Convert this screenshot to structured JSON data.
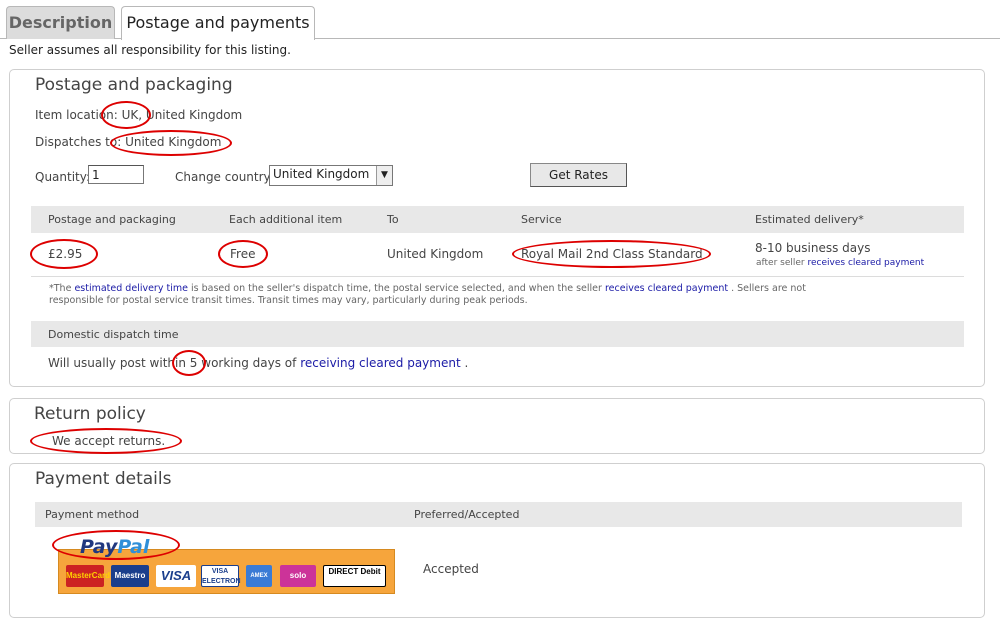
{
  "tabs": [
    {
      "label": "Description",
      "active": false
    },
    {
      "label": "Postage and payments",
      "active": true
    }
  ],
  "seller_note": "Seller assumes all responsibility for this listing.",
  "postage": {
    "title": "Postage and packaging",
    "item_location_label": "Item location:",
    "item_location_value": "UK, United Kingdom",
    "dispatches_label": "Dispatches to:",
    "dispatches_value": "United Kingdom",
    "quantity_label": "Quantity:",
    "quantity_value": "1",
    "country_label": "Change country:",
    "country_value": "United Kingdom",
    "get_rates_label": "Get Rates",
    "columns": [
      "Postage and packaging",
      "Each additional item",
      "To",
      "Service",
      "Estimated delivery*"
    ],
    "row": {
      "price": "£2.95",
      "additional": "Free",
      "to": "United Kingdom",
      "service": "Royal Mail 2nd Class Standard",
      "delivery": "8-10 business days",
      "delivery_note_prefix": "after seller",
      "delivery_note_link": "receives cleared payment"
    },
    "footnote_prefix": "*The",
    "footnote_link1": "estimated delivery time",
    "footnote_mid": "is based on the seller's dispatch time, the postal service selected, and when the seller",
    "footnote_link2": "receives cleared payment",
    "footnote_suffix": ". Sellers are not",
    "footnote_line2": "responsible for postal service transit times. Transit times may vary, particularly during peak periods.",
    "dispatch_header": "Domestic dispatch time",
    "dispatch_prefix": "Will usually post within",
    "dispatch_days": "5",
    "dispatch_mid": "working days of",
    "dispatch_link": "receiving cleared payment",
    "dispatch_suffix": "."
  },
  "returns": {
    "title": "Return policy",
    "text": "We accept returns."
  },
  "payment": {
    "title": "Payment details",
    "columns": [
      "Payment method",
      "Preferred/Accepted"
    ],
    "paypal_pay": "Pay",
    "paypal_pal": "Pal",
    "status": "Accepted",
    "cards": [
      {
        "label": "MasterCard",
        "bg": "#cc2222",
        "fg": "#ffd200"
      },
      {
        "label": "Maestro",
        "bg": "#1a3e8c",
        "fg": "#ffffff"
      },
      {
        "label": "VISA",
        "bg": "#ffffff",
        "fg": "#1a3e8c"
      },
      {
        "label": "VISA ELECTRON",
        "bg": "#ffffff",
        "fg": "#1a3e8c"
      },
      {
        "label": "AMEX",
        "bg": "#3a7bd5",
        "fg": "#ffffff"
      },
      {
        "label": "solo",
        "bg": "#cc3399",
        "fg": "#ffffff"
      },
      {
        "label": "DIRECT Debit",
        "bg": "#ffffff",
        "fg": "#000000"
      }
    ]
  },
  "colors": {
    "annotation": "#dd0000",
    "link": "#1a1aa6",
    "paypal_orange": "#f6a53c"
  }
}
